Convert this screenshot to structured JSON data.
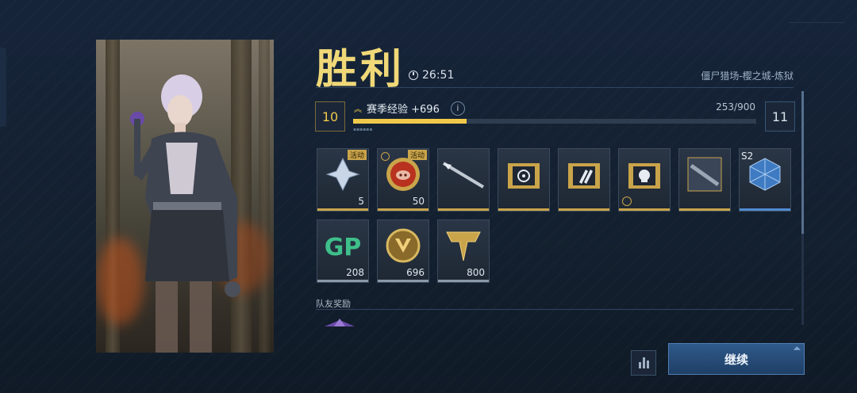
{
  "header": {
    "title": "胜利",
    "duration": "26:51",
    "mode": "僵尸猎场-樱之城-炼狱"
  },
  "progress": {
    "current_level": "10",
    "next_level": "11",
    "label": "赛季经验 +696",
    "count": "253/900",
    "fraction": 0.281,
    "accent": "#f0c94a"
  },
  "rewards": [
    {
      "icon": "crystal-shard-icon",
      "count": "5",
      "badge": "活动",
      "underline": "#c9a44a"
    },
    {
      "icon": "pig-coin-icon",
      "count": "50",
      "badge": "活动",
      "timer": true,
      "underline": "#c9a44a"
    },
    {
      "icon": "spear-weapon-icon",
      "count": "",
      "badge": "",
      "underline": "#c9a44a"
    },
    {
      "icon": "target-folder-icon",
      "count": "",
      "badge": "",
      "underline": "#c9a44a"
    },
    {
      "icon": "missile-folder-icon",
      "count": "",
      "badge": "",
      "underline": "#c9a44a"
    },
    {
      "icon": "skull-folder-icon",
      "count": "",
      "badge": "",
      "underline": "#c9a44a"
    },
    {
      "icon": "weapon-card-icon",
      "count": "",
      "badge": "",
      "underline": "#c9a44a"
    },
    {
      "icon": "blue-crate-icon",
      "count": "",
      "badge": "",
      "label": "S2",
      "underline": "#4f8ad0"
    },
    {
      "icon": "gp-coin-icon",
      "count": "208",
      "badge": "",
      "underline": "#8a99a8"
    },
    {
      "icon": "gold-emblem-icon",
      "count": "696",
      "badge": "",
      "underline": "#8a99a8"
    },
    {
      "icon": "rank-emblem-icon",
      "count": "800",
      "badge": "",
      "underline": "#8a99a8"
    }
  ],
  "team": {
    "label": "队友奖励"
  },
  "actions": {
    "continue_label": "继续"
  }
}
